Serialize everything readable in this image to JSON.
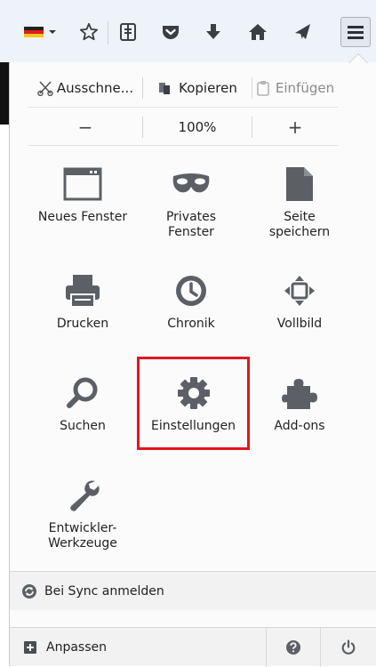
{
  "toolbar": {
    "icons": [
      "german-flag-icon",
      "dropdown-arrow-icon",
      "bookmark-star-icon",
      "reading-list-icon",
      "pocket-icon",
      "download-icon",
      "home-icon",
      "share-icon",
      "hamburger-menu-icon"
    ]
  },
  "edit": {
    "cut_label": "Ausschne...",
    "copy_label": "Kopieren",
    "paste_label": "Einfügen"
  },
  "zoom": {
    "minus_label": "−",
    "level": "100%",
    "plus_label": "+"
  },
  "grid": [
    {
      "label": "Neues Fenster",
      "icon": "window-icon"
    },
    {
      "label": "Privates\nFenster",
      "icon": "mask-icon"
    },
    {
      "label": "Seite\nspeichern",
      "icon": "page-icon"
    },
    {
      "label": "Drucken",
      "icon": "printer-icon"
    },
    {
      "label": "Chronik",
      "icon": "clock-icon"
    },
    {
      "label": "Vollbild",
      "icon": "fullscreen-icon"
    },
    {
      "label": "Suchen",
      "icon": "magnifier-icon"
    },
    {
      "label": "Einstellungen",
      "icon": "gear-icon"
    },
    {
      "label": "Add-ons",
      "icon": "puzzle-icon"
    },
    {
      "label": "Entwickler-\nWerkzeuge",
      "icon": "wrench-icon"
    }
  ],
  "sync": {
    "label": "Bei Sync anmelden",
    "icon": "sync-icon"
  },
  "footer": {
    "customize_label": "Anpassen",
    "help_icon": "help-icon",
    "quit_icon": "power-icon"
  },
  "colors": {
    "highlight": "#e0171f",
    "icon_gray": "#5c6066",
    "toolbar_bg": "#eef3fa"
  }
}
